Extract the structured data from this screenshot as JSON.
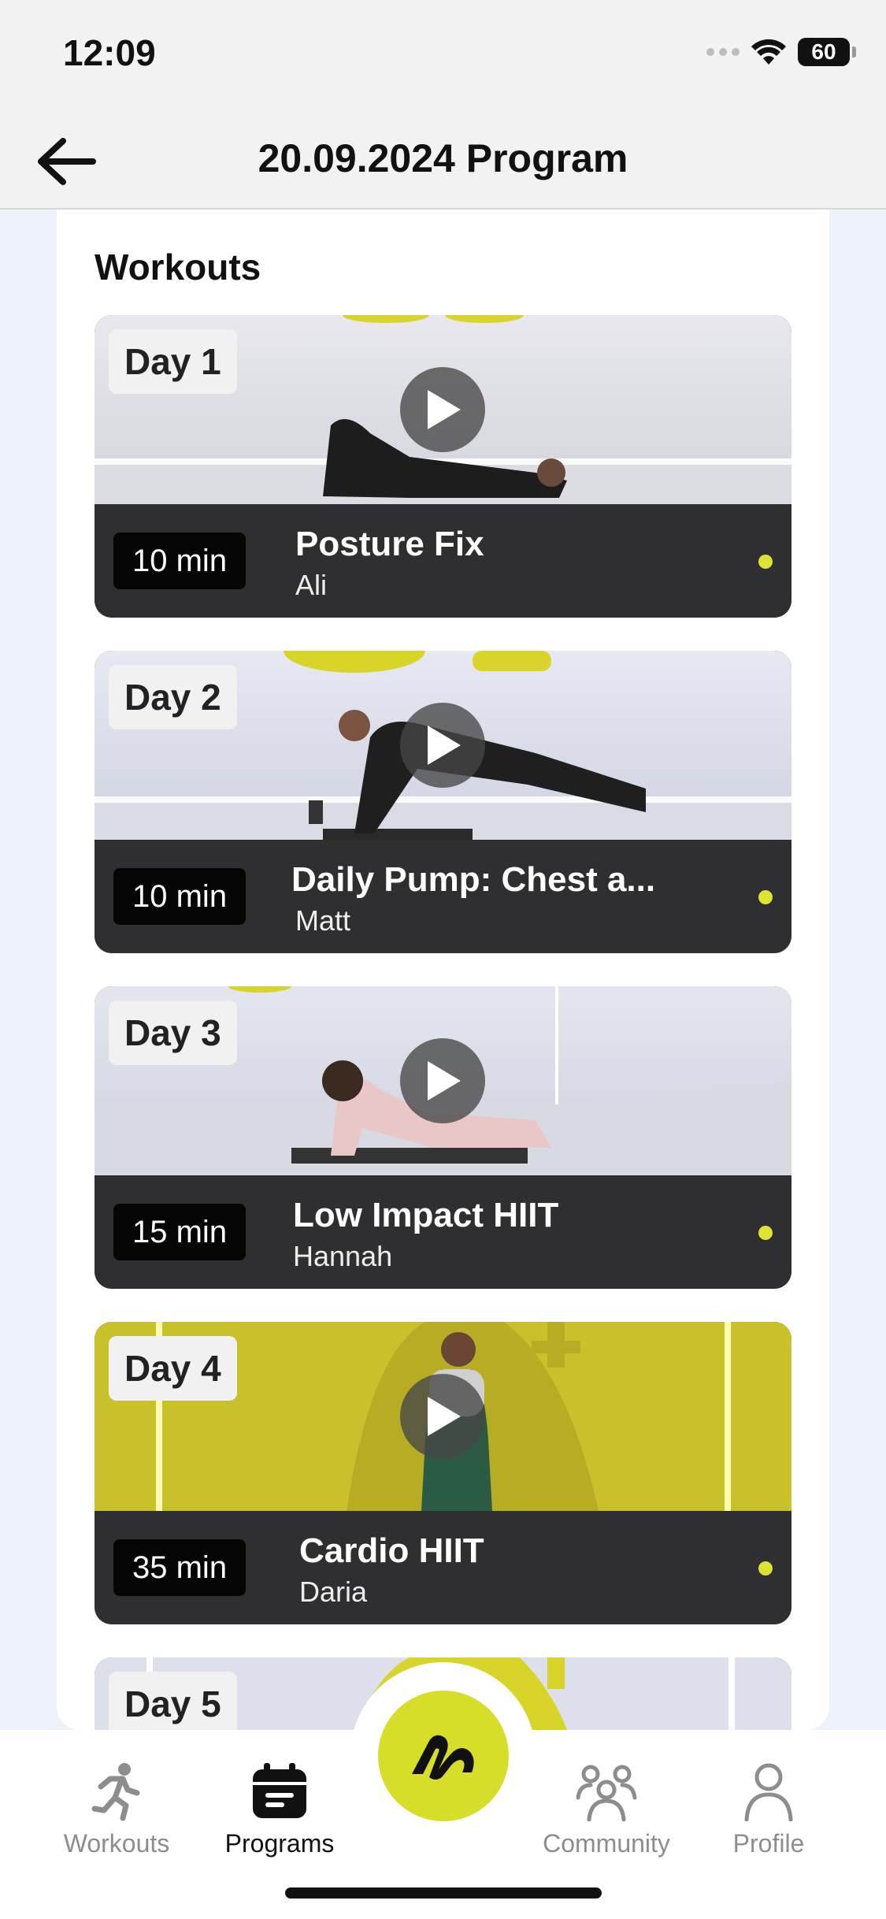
{
  "status_bar": {
    "time": "12:09",
    "battery": "60"
  },
  "header": {
    "title": "20.09.2024 Program"
  },
  "section": {
    "title": "Workouts"
  },
  "workouts": [
    {
      "day": "Day 1",
      "duration": "10 min",
      "title": "Posture Fix",
      "trainer": "Ali"
    },
    {
      "day": "Day 2",
      "duration": "10 min",
      "title": "Daily Pump: Chest a...",
      "trainer": "Matt"
    },
    {
      "day": "Day 3",
      "duration": "15 min",
      "title": "Low Impact HIIT",
      "trainer": "Hannah"
    },
    {
      "day": "Day 4",
      "duration": "35 min",
      "title": "Cardio HIIT",
      "trainer": "Daria"
    },
    {
      "day": "Day 5"
    }
  ],
  "nav": {
    "workouts": "Workouts",
    "programs": "Programs",
    "community": "Community",
    "profile": "Profile"
  },
  "colors": {
    "accent": "#d6de29",
    "card_dark": "#2f2f31",
    "background": "#eef3fb"
  }
}
